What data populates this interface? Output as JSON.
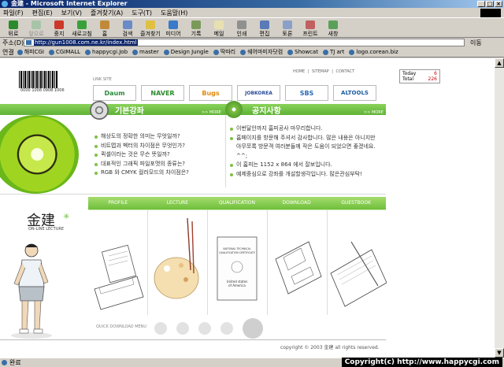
{
  "window": {
    "title": "金建 - Microsoft Internet Explorer"
  },
  "menu": [
    "파일(F)",
    "편집(E)",
    "보기(V)",
    "즐겨찾기(A)",
    "도구(T)",
    "도움말(H)"
  ],
  "toolbar": {
    "back": "뒤로",
    "forward": "앞으로",
    "stop": "중지",
    "refresh": "새로고침",
    "home": "홈",
    "search": "검색",
    "favorites": "즐겨찾기",
    "media": "미디어",
    "history": "기록",
    "mail": "메일",
    "print": "인쇄",
    "edit": "편집",
    "discuss": "토론",
    "print2": "프린트",
    "messenger": "새창"
  },
  "address": {
    "label": "주소(D)",
    "url": "http://gun1008.com.ne.kr/index.html",
    "go": "이동"
  },
  "links": {
    "label": "연결",
    "items": [
      "해피CGI",
      "CGIMALL",
      "happycgi.Job",
      "master",
      "Design Jungle",
      "딱따리",
      "쉐어마미자닷컴",
      "Showcat",
      "TJ art",
      "logo.corean.biz"
    ]
  },
  "page": {
    "barcode_number": "0000 1008 0908 1006",
    "link_site": "LINK SITE",
    "top_links": "HOME  |  SITEMAP  |  CONTACT",
    "partners": [
      "Daum",
      "NAVER",
      "Bugs",
      "JOBKOREA",
      "SBS",
      "ALTOOLS"
    ],
    "counter": {
      "today_label": "Today",
      "today": "6",
      "total_label": "Total",
      "total": "226"
    },
    "basic_title": "기본강좌",
    "notice_title": "공지사항",
    "more": ">> MORE",
    "basic_items": [
      "해상도의 정확한 의미는 무엇일까?",
      "비트맵과 벡터의 차이점은 무엇인가?",
      "퀵셀이라는 것은 무슨 뜻일까?",
      "대표적인 그래픽 파일포맷의 종류는?",
      "RGB 와 CMYK 컬러모드의 차이점은?"
    ],
    "notice_items": [
      "이번달안까지 홈피공사 마무리합니다.",
      "홈페이지를 방문해 주셔서 감사합니다. 많은 내용은 아니지만 아무쪼록 방문객 여러분들께 작은 도움이 되었으면 좋겠네요. ^^;",
      "이 홈피는 1152 x 864 에서 잘보입니다.",
      "예제중심으로 강좌를 개설할생각입니다. 많은관심부탁!"
    ],
    "nav": [
      "PROFILE",
      "LECTURE",
      "QUALIFICATION",
      "DOWNLOAD",
      "GUESTBOOK"
    ],
    "calligraphy": "金建",
    "online_lecture": "ON-LINE LECTURE",
    "quick_download": "QUICK DOWNLOAD MENU",
    "certificate": {
      "line1": "NATIONAL TECHNICAL",
      "line2": "QUALIFICATION CERTIFICATE",
      "line3": "United states",
      "line4": "of America"
    },
    "copyright": "copyright © 2003 金建 all rights reserved."
  },
  "status": {
    "text": "완료"
  },
  "watermark": "Copyright(c) http://www.happycgi.com"
}
